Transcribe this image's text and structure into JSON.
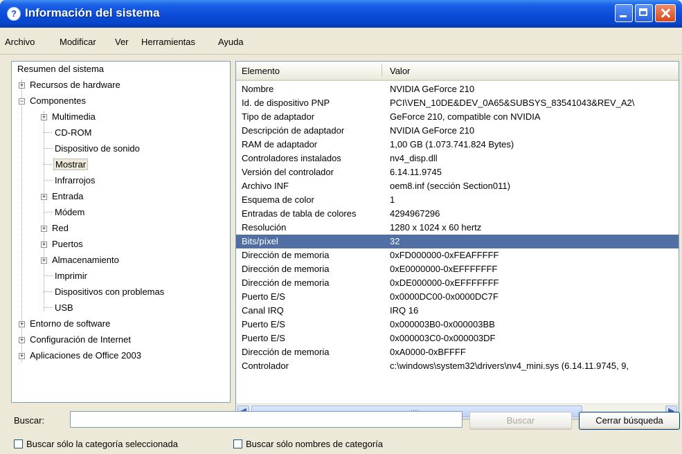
{
  "window": {
    "title": "Información del sistema",
    "icon_glyph": "?"
  },
  "menu": [
    "Archivo",
    "Modificar",
    "Ver",
    "Herramientas",
    "Ayuda"
  ],
  "tree": [
    {
      "label": "Resumen del sistema"
    },
    {
      "label": "Recursos de hardware"
    },
    {
      "label": "Componentes"
    },
    {
      "label": "Multimedia"
    },
    {
      "label": "CD-ROM"
    },
    {
      "label": "Dispositivo de sonido"
    },
    {
      "label": "Mostrar",
      "selected": true
    },
    {
      "label": "Infrarrojos"
    },
    {
      "label": "Entrada"
    },
    {
      "label": "Módem"
    },
    {
      "label": "Red"
    },
    {
      "label": "Puertos"
    },
    {
      "label": "Almacenamiento"
    },
    {
      "label": "Imprimir"
    },
    {
      "label": "Dispositivos con problemas"
    },
    {
      "label": "USB"
    },
    {
      "label": "Entorno de software"
    },
    {
      "label": "Configuración de Internet"
    },
    {
      "label": "Aplicaciones de Office 2003"
    }
  ],
  "list": {
    "columns": [
      "Elemento",
      "Valor"
    ],
    "rows": [
      [
        "Nombre",
        "NVIDIA GeForce 210"
      ],
      [
        "Id. de dispositivo PNP",
        "PCI\\VEN_10DE&DEV_0A65&SUBSYS_83541043&REV_A2\\"
      ],
      [
        "Tipo de adaptador",
        "GeForce 210, compatible con NVIDIA"
      ],
      [
        "Descripción de adaptador",
        "NVIDIA GeForce 210"
      ],
      [
        "RAM de adaptador",
        "1,00 GB (1.073.741.824 Bytes)"
      ],
      [
        "Controladores instalados",
        "nv4_disp.dll"
      ],
      [
        "Versión del controlador",
        "6.14.11.9745"
      ],
      [
        "Archivo INF",
        "oem8.inf (sección Section011)"
      ],
      [
        "Esquema de color",
        "1"
      ],
      [
        "Entradas de tabla de colores",
        "4294967296"
      ],
      [
        "Resolución",
        "1280 x 1024 x 60 hertz"
      ],
      [
        "Bits/píxel",
        "32"
      ],
      [
        "Dirección de memoria",
        "0xFD000000-0xFEAFFFFF"
      ],
      [
        "Dirección de memoria",
        "0xE0000000-0xEFFFFFFF"
      ],
      [
        "Dirección de memoria",
        "0xDE000000-0xEFFFFFFF"
      ],
      [
        "Puerto E/S",
        "0x0000DC00-0x0000DC7F"
      ],
      [
        "Canal IRQ",
        "IRQ 16"
      ],
      [
        "Puerto E/S",
        "0x000003B0-0x000003BB"
      ],
      [
        "Puerto E/S",
        "0x000003C0-0x000003DF"
      ],
      [
        "Dirección de memoria",
        "0xA0000-0xBFFFF"
      ],
      [
        "Controlador",
        "c:\\windows\\system32\\drivers\\nv4_mini.sys (6.14.11.9745, 9,"
      ]
    ],
    "selected_row": 11
  },
  "search": {
    "label": "Buscar:",
    "value": "",
    "button_search": "Buscar",
    "button_close": "Cerrar búsqueda",
    "check_selected_category": "Buscar sólo la categoría seleccionada",
    "check_category_names": "Buscar sólo nombres de categoría"
  },
  "colors": {
    "titlebar": "#0A4BD8",
    "selection": "#526FA3",
    "face": "#ECE9D8"
  }
}
